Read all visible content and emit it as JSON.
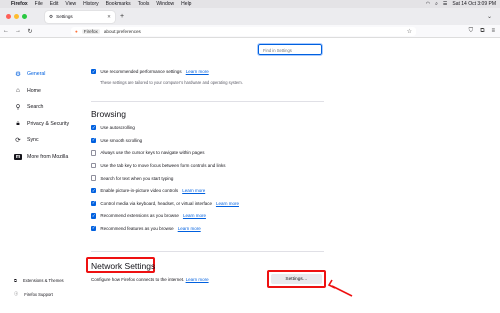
{
  "menubar": {
    "app": "Firefox",
    "items": [
      "File",
      "Edit",
      "View",
      "History",
      "Bookmarks",
      "Tools",
      "Window",
      "Help"
    ],
    "clock": "Sat 14 Oct 3:09 PM"
  },
  "tab": {
    "title": "Settings"
  },
  "urlbar": {
    "identity": "Firefox",
    "url": "about:preferences"
  },
  "search": {
    "placeholder": "Find in Settings"
  },
  "sidebar": {
    "items": [
      {
        "label": "General",
        "icon": "gear-icon",
        "active": true
      },
      {
        "label": "Home",
        "icon": "home-icon"
      },
      {
        "label": "Search",
        "icon": "search-icon"
      },
      {
        "label": "Privacy & Security",
        "icon": "lock-icon"
      },
      {
        "label": "Sync",
        "icon": "sync-icon"
      },
      {
        "label": "More from Mozilla",
        "icon": "mozilla-icon"
      }
    ],
    "footer": [
      {
        "label": "Extensions & Themes",
        "icon": "puzzle-icon"
      },
      {
        "label": "Firefox Support",
        "icon": "help-icon"
      }
    ]
  },
  "performance": {
    "label": "Use recommended performance settings",
    "link": "Learn more",
    "checked": true,
    "note": "These settings are tailored to your computer’s hardware and operating system."
  },
  "browsing": {
    "heading": "Browsing",
    "options": [
      {
        "label": "Use autoscrolling",
        "checked": true,
        "link": ""
      },
      {
        "label": "Use smooth scrolling",
        "checked": true,
        "link": ""
      },
      {
        "label": "Always use the cursor keys to navigate within pages",
        "checked": false,
        "link": ""
      },
      {
        "label": "Use the tab key to move focus between form controls and links",
        "checked": false,
        "link": ""
      },
      {
        "label": "Search for text when you start typing",
        "checked": false,
        "link": ""
      },
      {
        "label": "Enable picture-in-picture video controls",
        "checked": true,
        "link": "Learn more"
      },
      {
        "label": "Control media via keyboard, headset, or virtual interface",
        "checked": true,
        "link": "Learn more"
      },
      {
        "label": "Recommend extensions as you browse",
        "checked": true,
        "link": "Learn more"
      },
      {
        "label": "Recommend features as you browse",
        "checked": true,
        "link": "Learn more"
      }
    ]
  },
  "network": {
    "heading": "Network Settings",
    "description": "Configure how Firefox connects to the internet.",
    "link": "Learn more",
    "button": "Settings…"
  },
  "colors": {
    "accent": "#0060df",
    "highlight": "#e11111"
  }
}
